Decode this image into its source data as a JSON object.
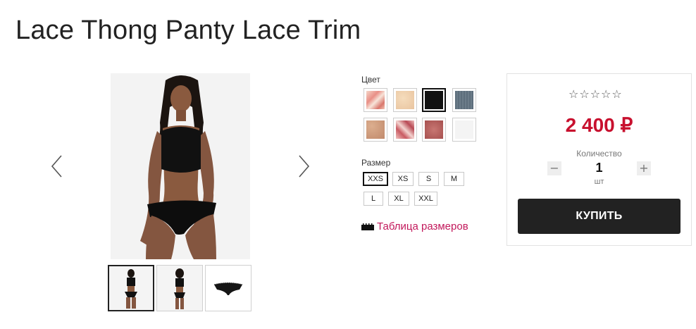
{
  "product": {
    "title": "Lace Thong Panty Lace Trim"
  },
  "gallery": {
    "prev_icon": "chevron-left-icon",
    "next_icon": "chevron-right-icon",
    "thumbnails": [
      "model-front",
      "model-back",
      "product-flat"
    ],
    "active_thumbnail": 0
  },
  "options": {
    "color_label": "Цвет",
    "colors": [
      {
        "name": "floral-pink",
        "hex": "#f2c0b0",
        "selected": false
      },
      {
        "name": "nude",
        "hex": "#efcfae",
        "selected": false
      },
      {
        "name": "black",
        "hex": "#111111",
        "selected": true
      },
      {
        "name": "slate-blue",
        "hex": "#5d6e7c",
        "selected": false
      },
      {
        "name": "tan-lace",
        "hex": "#cfa081",
        "selected": false
      },
      {
        "name": "pink-print",
        "hex": "#e6a3a3",
        "selected": false
      },
      {
        "name": "rose-lace",
        "hex": "#b7615f",
        "selected": false
      },
      {
        "name": "white",
        "hex": "#f4f4f4",
        "selected": false
      }
    ],
    "size_label": "Размер",
    "sizes": [
      {
        "label": "XXS",
        "selected": true
      },
      {
        "label": "XS",
        "selected": false
      },
      {
        "label": "S",
        "selected": false
      },
      {
        "label": "M",
        "selected": false
      },
      {
        "label": "L",
        "selected": false
      },
      {
        "label": "XL",
        "selected": false
      },
      {
        "label": "XXL",
        "selected": false
      }
    ],
    "size_chart_icon": "ruler-icon",
    "size_chart_label": "Таблица размеров"
  },
  "buy": {
    "rating_stars": 0,
    "rating_max": 5,
    "price": "2 400 ₽",
    "quantity_label": "Количество",
    "quantity": "1",
    "unit": "шт",
    "minus": "−",
    "plus": "+",
    "buy_label": "КУПИТЬ"
  },
  "colors": {
    "price": "#c8102e",
    "size_chart_link": "#c2185b",
    "buy_button": "#222222"
  }
}
